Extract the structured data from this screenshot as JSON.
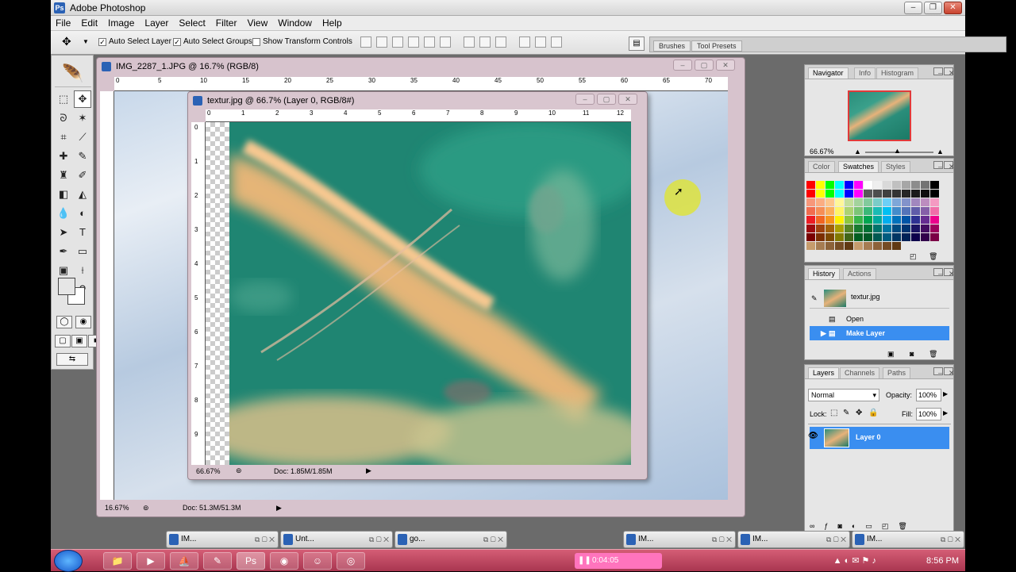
{
  "app": {
    "title": "Adobe Photoshop"
  },
  "menu": [
    "File",
    "Edit",
    "Image",
    "Layer",
    "Select",
    "Filter",
    "View",
    "Window",
    "Help"
  ],
  "options": {
    "auto_select_layer": "Auto Select Layer",
    "auto_select_groups": "Auto Select Groups",
    "show_transform_controls": "Show Transform Controls",
    "brushes_tab": "Brushes",
    "tool_presets_tab": "Tool Presets"
  },
  "doc1": {
    "title": "IMG_2287_1.JPG @ 16.7% (RGB/8)",
    "zoom": "16.67%",
    "doc_size": "Doc: 51.3M/51.3M",
    "ruler_ticks": [
      "0",
      "5",
      "10",
      "15",
      "20",
      "25",
      "30",
      "35",
      "40",
      "45",
      "50",
      "55",
      "60",
      "65",
      "70"
    ]
  },
  "doc2": {
    "title": "textur.jpg @ 66.7% (Layer 0, RGB/8#)",
    "zoom": "66.67%",
    "doc_size": "Doc: 1.85M/1.85M",
    "ruler_ticks": [
      "0",
      "1",
      "2",
      "3",
      "4",
      "5",
      "6",
      "7",
      "8",
      "9",
      "10",
      "11",
      "12"
    ],
    "vruler_ticks": [
      "0",
      "1",
      "2",
      "3",
      "4",
      "5",
      "6",
      "7",
      "8",
      "9"
    ]
  },
  "navigator": {
    "tabs": [
      "Navigator",
      "Info",
      "Histogram"
    ],
    "zoom": "66.67%"
  },
  "swatches": {
    "tabs": [
      "Color",
      "Swatches",
      "Styles"
    ],
    "colors": [
      "#ff0000",
      "#ffff00",
      "#00ff00",
      "#00ffff",
      "#0000ff",
      "#ff00ff",
      "#ffffff",
      "#eeeeee",
      "#d9d9d9",
      "#c0c0c0",
      "#a6a6a6",
      "#8c8c8c",
      "#737373",
      "#000000",
      "#ff0000",
      "#ffff00",
      "#00ff00",
      "#00ffff",
      "#0000ff",
      "#ff00ff",
      "#595959",
      "#4d4d4d",
      "#404040",
      "#333333",
      "#262626",
      "#1a1a1a",
      "#0d0d0d",
      "#000000",
      "#f7977a",
      "#fbad82",
      "#fdc68c",
      "#fff799",
      "#c4df9b",
      "#a3d39c",
      "#82ca9c",
      "#7accc8",
      "#6dcff6",
      "#7ea7d8",
      "#8393ca",
      "#a187be",
      "#bc8dbf",
      "#f49ac2",
      "#f26c4f",
      "#f68e56",
      "#fbaf5c",
      "#fff467",
      "#acd372",
      "#7cc576",
      "#3bb878",
      "#1abbb4",
      "#00bff3",
      "#438ccb",
      "#5574b9",
      "#605ca9",
      "#855fa8",
      "#f06ea9",
      "#ed1c24",
      "#f26522",
      "#f7941d",
      "#fff200",
      "#8dc63f",
      "#39b54a",
      "#00a651",
      "#00a99d",
      "#00aeef",
      "#0072bc",
      "#0054a6",
      "#2e3192",
      "#662d91",
      "#ec008c",
      "#9e0b0f",
      "#a0410d",
      "#a36209",
      "#aba000",
      "#598527",
      "#1a7b30",
      "#007236",
      "#00746b",
      "#0076a3",
      "#004b80",
      "#003471",
      "#1b1464",
      "#440e62",
      "#9e005d",
      "#790000",
      "#7b2e00",
      "#7d4900",
      "#827b00",
      "#406618",
      "#005e20",
      "#005826",
      "#005952",
      "#005b7f",
      "#003663",
      "#002157",
      "#0d004c",
      "#32004b",
      "#7b0046",
      "#c69c6d",
      "#a67c52",
      "#8c6239",
      "#754c24",
      "#603913",
      "#c69c6d",
      "#a67c52",
      "#8c6239",
      "#754c24",
      "#603913"
    ]
  },
  "history": {
    "tabs": [
      "History",
      "Actions"
    ],
    "snapshot": "textur.jpg",
    "items": [
      "Open",
      "Make Layer"
    ]
  },
  "layers": {
    "tabs": [
      "Layers",
      "Channels",
      "Paths"
    ],
    "blend": "Normal",
    "opacity_label": "Opacity:",
    "opacity": "100%",
    "lock_label": "Lock:",
    "fill_label": "Fill:",
    "fill": "100%",
    "layer_name": "Layer 0"
  },
  "taskbar_windows": [
    "IM...",
    "Unt...",
    "go...",
    "IM...",
    "IM...",
    "IM..."
  ],
  "recorder": "0:04:05",
  "clock": "8:56 PM"
}
